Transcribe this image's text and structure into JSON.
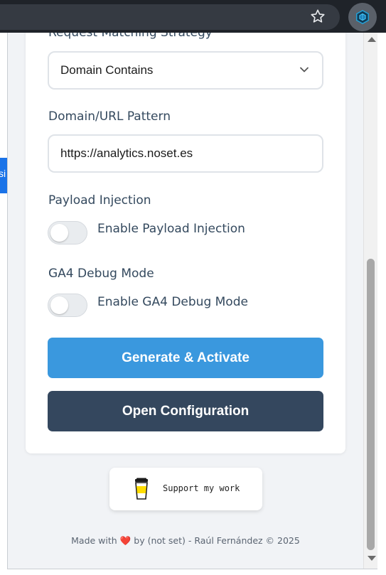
{
  "browser": {
    "bookmark_icon": "star-icon",
    "extension_icon": "cube-icon",
    "page_peek_text": "si"
  },
  "form": {
    "matching_label": "Request Matching Strategy",
    "matching_value": "Domain Contains",
    "pattern_label": "Domain/URL Pattern",
    "pattern_value": "https://analytics.noset.es",
    "payload_label": "Payload Injection",
    "payload_toggle_label": "Enable Payload Injection",
    "payload_enabled": false,
    "debug_label": "GA4 Debug Mode",
    "debug_toggle_label": "Enable GA4 Debug Mode",
    "debug_enabled": false
  },
  "buttons": {
    "generate_label": "Generate & Activate",
    "config_label": "Open Configuration"
  },
  "support": {
    "label": "Support my work",
    "icon": "coffee-cup-icon"
  },
  "footer": {
    "prefix": "Made with",
    "suffix": "by (not set) - Raúl Fernández © 2025"
  },
  "colors": {
    "primary": "#3a98de",
    "dark": "#34475e",
    "text": "#34495e"
  }
}
